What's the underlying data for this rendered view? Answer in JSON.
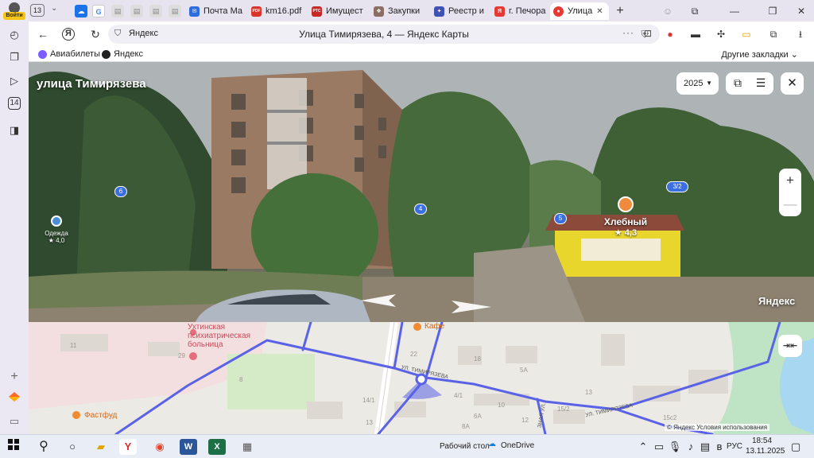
{
  "rail": {
    "login_label": "Войти",
    "items": [
      {
        "icon": "history-icon",
        "glyph": "◴"
      },
      {
        "icon": "collections-icon",
        "glyph": "❐"
      },
      {
        "icon": "video-icon",
        "glyph": "▷"
      },
      {
        "icon": "calendar-icon",
        "glyph": "14"
      },
      {
        "icon": "messenger-icon",
        "glyph": "◨"
      }
    ],
    "add_glyph": "+"
  },
  "tabs": {
    "count": "13",
    "items": [
      {
        "label": "Почта Ма",
        "color": "#2d6cdf",
        "glyph": "✉"
      },
      {
        "label": "km16.pdf",
        "color": "#d9342b",
        "glyph": "PDF"
      },
      {
        "label": "Имущест",
        "color": "#c62828",
        "glyph": "РТС"
      },
      {
        "label": "Закупки",
        "color": "#8d6e63",
        "glyph": "❖"
      },
      {
        "label": "Реестр и",
        "color": "#3f51b5",
        "glyph": "✦"
      },
      {
        "label": "г. Печора",
        "color": "#e53935",
        "glyph": "Я"
      },
      {
        "label": "Улица",
        "color": "#e53935",
        "glyph": "●"
      }
    ],
    "new_tab": "+"
  },
  "window": {
    "minimize": "—",
    "maximize": "❐",
    "close": "✕",
    "collections": "⧉",
    "profile_glyph": "☺"
  },
  "addressbar": {
    "domain": "Яндекс",
    "page_title": "Улица Тимирязева, 4 — Яндекс Карты",
    "more": "···",
    "back": "←",
    "yandex_glyph": "Я",
    "refresh": "↻"
  },
  "bookmarks": {
    "items": [
      {
        "label": "Авиабилеты",
        "color": "#7b5cff"
      },
      {
        "label": "Яндекс",
        "color": "#222222"
      }
    ],
    "other": "Другие закладки"
  },
  "panorama": {
    "street": "улица Тимирязева",
    "year": "2025",
    "brand": "Яндекс",
    "markers": [
      "6",
      "4",
      "5",
      "3/2"
    ],
    "pois": [
      {
        "name": "Хлебный",
        "rating": "★ 4,3"
      },
      {
        "name": "Одежда",
        "rating": "★ 4,0"
      }
    ],
    "zoom_in": "+",
    "zoom_out": "—"
  },
  "map": {
    "labels": {
      "hospital_1": "Ухтинская",
      "hospital_2": "психиатрическая",
      "hospital_3": "больница",
      "cafe": "Кафе",
      "fastfood": "Фастфуд",
      "street_1": "УЛ. ТИМИРЯЗЕВА",
      "street_2": "УЛ. ТИМИРЯЗЕВА",
      "side_street": "ЗНАЯ УЛ."
    },
    "house_numbers": [
      "11",
      "29",
      "22",
      "18",
      "8",
      "5А",
      "13",
      "15/2",
      "10",
      "12",
      "6А",
      "8А",
      "14/1",
      "4/1",
      "13",
      "15с2"
    ],
    "copyright": "© Яндекс  Условия использования"
  },
  "taskbar": {
    "desktop": "Рабочий стол",
    "onedrive": "OneDrive",
    "lang": "РУС",
    "time": "18:54",
    "date": "13.11.2025"
  }
}
